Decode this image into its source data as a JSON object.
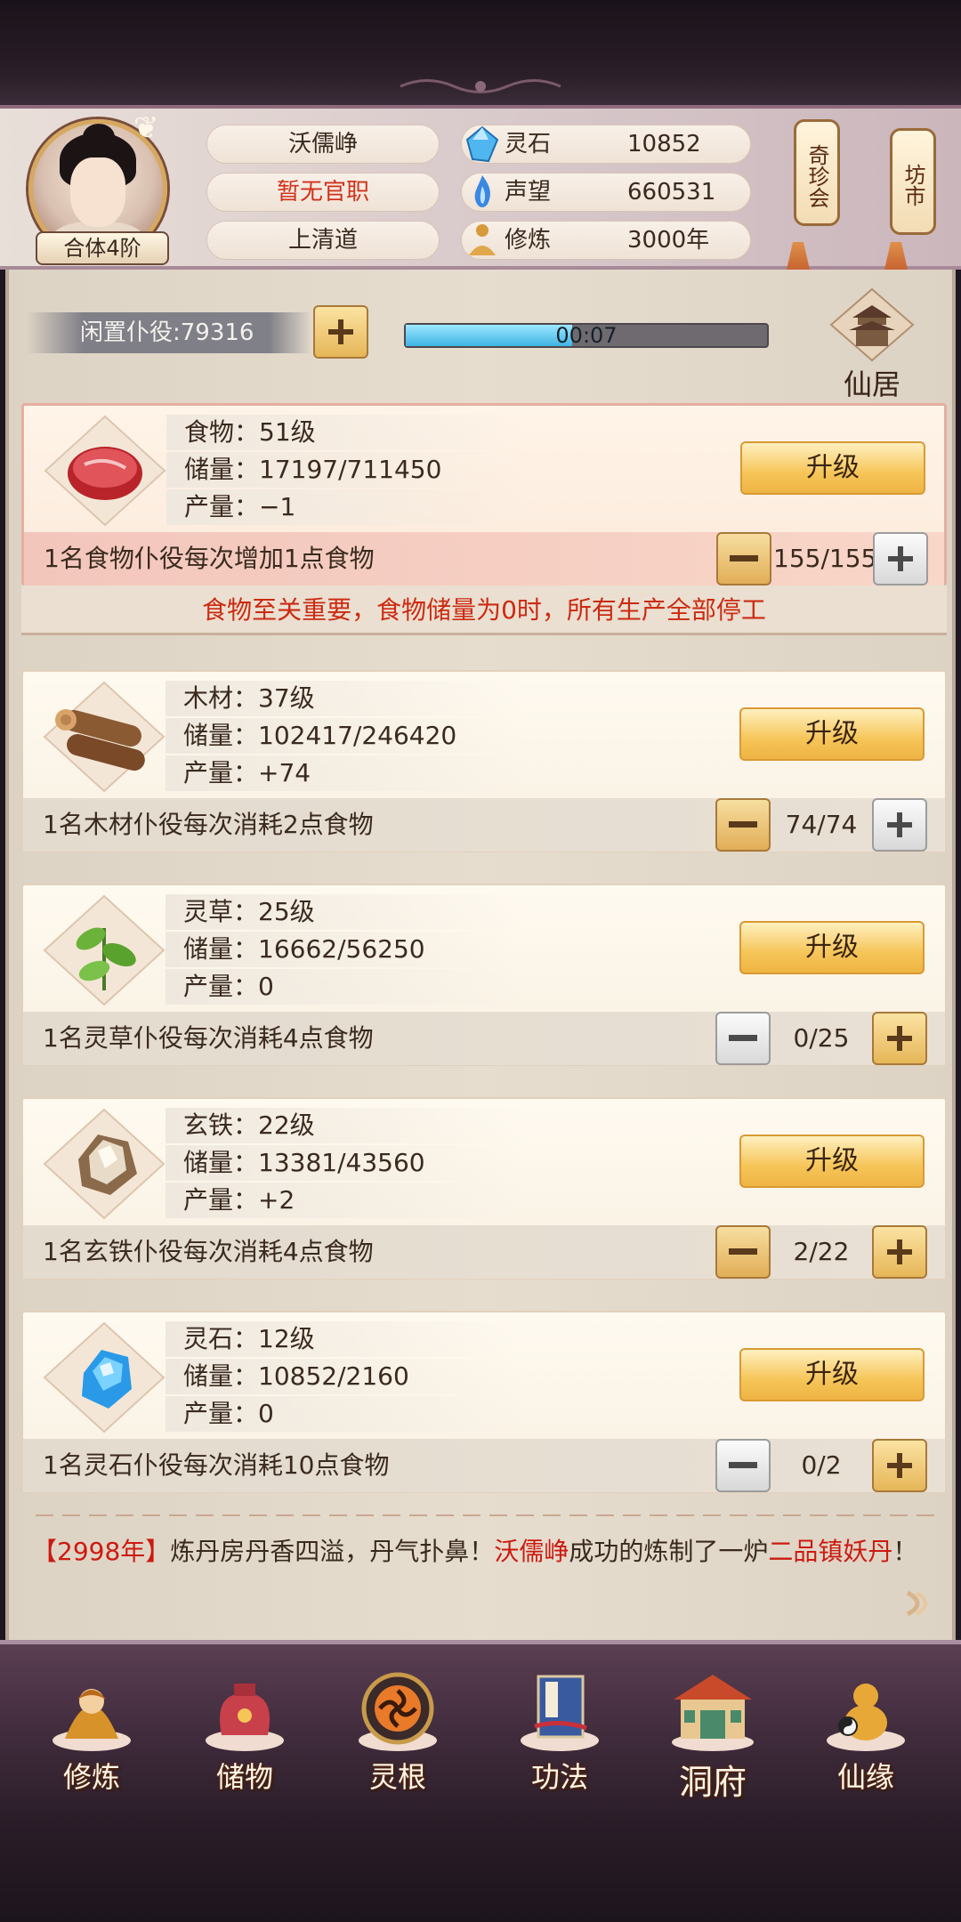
{
  "player": {
    "name": "沃儒峥",
    "official": "暂无官职",
    "sect": "上清道",
    "rank": "合体4阶"
  },
  "stats": [
    {
      "label": "灵石",
      "value": "10852",
      "icon": "blue-crystal-icon"
    },
    {
      "label": "声望",
      "value": "660531",
      "icon": "blue-flame-icon"
    },
    {
      "label": "修炼",
      "value": "3000年",
      "icon": "meditating-figure-icon"
    }
  ],
  "hanging_signs": {
    "treasure": "奇珍会",
    "market": "坊市"
  },
  "idle_servants": {
    "label": "闲置仆役:79316"
  },
  "timer": {
    "text": "00:07",
    "progress": 0.46
  },
  "residence": {
    "label": "仙居"
  },
  "upgrade_label": "升级",
  "resources": [
    {
      "name_line": "食物：51级",
      "storage_line": "储量：17197/711450",
      "output_line": "产量：−1",
      "desc": "1名食物仆役每次增加1点食物",
      "count": "155/155",
      "icon": "raw-meat-icon"
    },
    {
      "name_line": "木材：37级",
      "storage_line": "储量：102417/246420",
      "output_line": "产量：+74",
      "desc": "1名木材仆役每次消耗2点食物",
      "count": "74/74",
      "icon": "wood-logs-icon"
    },
    {
      "name_line": "灵草：25级",
      "storage_line": "储量：16662/56250",
      "output_line": "产量：0",
      "desc": "1名灵草仆役每次消耗4点食物",
      "count": "0/25",
      "icon": "herb-leaf-icon"
    },
    {
      "name_line": "玄铁：22级",
      "storage_line": "储量：13381/43560",
      "output_line": "产量：+2",
      "desc": "1名玄铁仆役每次消耗4点食物",
      "count": "2/22",
      "icon": "iron-ore-icon"
    },
    {
      "name_line": "灵石：12级",
      "storage_line": "储量：10852/2160",
      "output_line": "产量：0",
      "desc": "1名灵石仆役每次消耗10点食物",
      "count": "0/2",
      "icon": "spirit-stone-icon"
    }
  ],
  "food_warning": "食物至关重要，食物储量为0时，所有生产全部停工",
  "log": {
    "bracket_open": "【",
    "year": "2998年",
    "bracket_close": "】",
    "text1": "炼丹房丹香四溢，丹气扑鼻！",
    "name": "沃儒峥",
    "text2": "成功的炼制了一炉",
    "grade": "二品镇妖丹",
    "end": "！"
  },
  "nav": [
    {
      "label": "修炼",
      "icon": "cultivation-monk-icon"
    },
    {
      "label": "储物",
      "icon": "storage-bag-icon"
    },
    {
      "label": "灵根",
      "icon": "spirit-root-swirl-icon"
    },
    {
      "label": "功法",
      "icon": "technique-book-icon"
    },
    {
      "label": "洞府",
      "icon": "cave-mansion-icon"
    },
    {
      "label": "仙缘",
      "icon": "gourd-fate-icon"
    }
  ],
  "colors": {
    "accent_gold": "#f6c558",
    "warning_red": "#cc2a12",
    "progress_blue": "#3fb4e4"
  }
}
